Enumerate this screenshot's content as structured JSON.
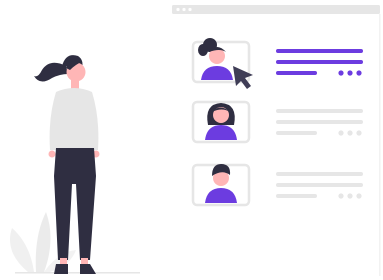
{
  "illustration": {
    "accent_color": "#6c3ce0",
    "card_border_color": "#e6e6e6",
    "line_gray_color": "#e6e6e6",
    "hair_color": "#2f2e41",
    "skin_color": "#ffb6b6",
    "shirt_color": "#e6e6e6",
    "pants_color": "#2f2e41",
    "cursor_color": "#3f3d56"
  },
  "profiles": [
    {
      "name": "profile-card-1",
      "selected": true,
      "avatar": "ponytail-woman-avatar"
    },
    {
      "name": "profile-card-2",
      "selected": false,
      "avatar": "bob-hair-woman-avatar"
    },
    {
      "name": "profile-card-3",
      "selected": false,
      "avatar": "short-hair-man-avatar"
    }
  ],
  "window_controls": [
    "dot",
    "dot",
    "dot"
  ]
}
